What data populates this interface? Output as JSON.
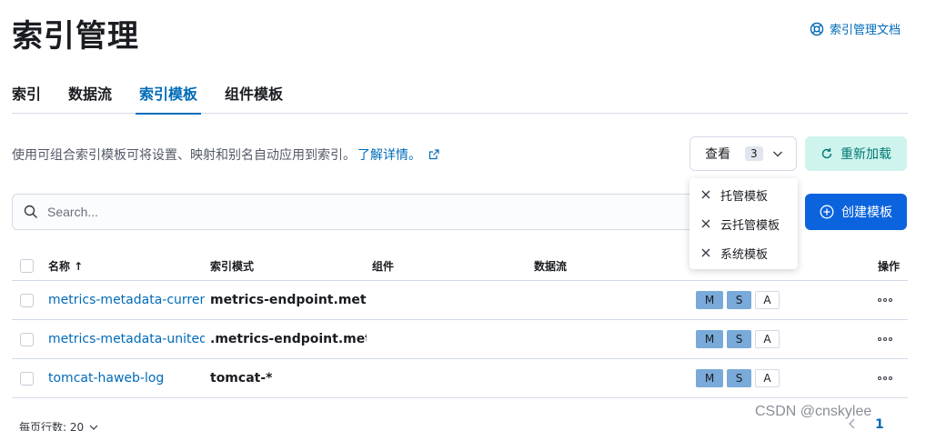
{
  "page": {
    "title": "索引管理",
    "docs_link": "索引管理文档"
  },
  "tabs": [
    {
      "label": "索引"
    },
    {
      "label": "数据流"
    },
    {
      "label": "索引模板"
    },
    {
      "label": "组件模板"
    }
  ],
  "active_tab": "索引模板",
  "description": {
    "text": "使用可组合索引模板可将设置、映射和别名自动应用到索引。",
    "learn_more": "了解详情。"
  },
  "view_filter": {
    "label": "查看",
    "count": "3",
    "options": [
      {
        "label": "托管模板"
      },
      {
        "label": "云托管模板"
      },
      {
        "label": "系统模板"
      }
    ]
  },
  "reload_button": "重新加载",
  "search": {
    "placeholder": "Search..."
  },
  "create_button": "创建模板",
  "table": {
    "columns": {
      "name": "名称 ↑",
      "pattern": "索引模式",
      "components": "组件",
      "data_stream": "数据流",
      "type": "",
      "actions": "操作"
    },
    "rows": [
      {
        "name": "metrics-metadata-current",
        "pattern": "metrics-endpoint.metadata_current_default",
        "badges": [
          "M",
          "S",
          "A"
        ]
      },
      {
        "name": "metrics-metadata-united",
        "pattern": ".metrics-endpoint.metadata_united_default",
        "badges": [
          "M",
          "S",
          "A"
        ]
      },
      {
        "name": "tomcat-haweb-log",
        "pattern": "tomcat-*",
        "badges": [
          "M",
          "S",
          "A"
        ]
      }
    ]
  },
  "footer": {
    "rows_per_page": "每页行数: 20",
    "current_page": "1"
  },
  "watermark": "CSDN @cnskylee",
  "colors": {
    "primary": "#006bb8",
    "create_button": "#0b64dd",
    "reload_bg": "#cff4ee",
    "reload_text": "#007871",
    "badge_fill": "#79aad9"
  }
}
